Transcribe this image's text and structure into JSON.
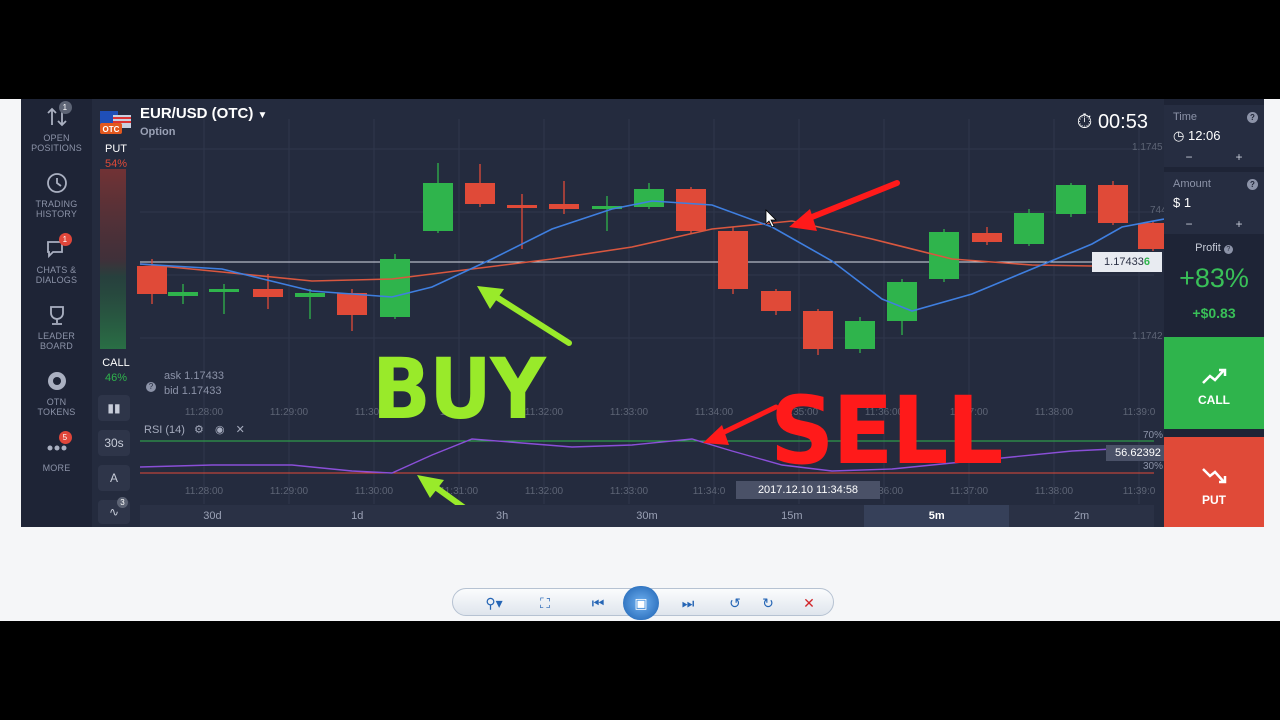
{
  "pair": {
    "title": "EUR/USD (OTC)",
    "subtitle": "Option",
    "flag_text": "OTC"
  },
  "timer": "00:53",
  "sidebar": {
    "items": [
      {
        "label1": "OPEN",
        "label2": "POSITIONS",
        "badge": "1"
      },
      {
        "label1": "TRADING",
        "label2": "HISTORY",
        "badge": ""
      },
      {
        "label1": "CHATS &",
        "label2": "DIALOGS",
        "badge": "1"
      },
      {
        "label1": "LEADER",
        "label2": "BOARD",
        "badge": ""
      },
      {
        "label1": "OTN",
        "label2": "TOKENS",
        "badge": ""
      },
      {
        "label1": "MORE",
        "label2": "",
        "badge": "5"
      }
    ]
  },
  "sentiment": {
    "put_label": "PUT",
    "put_pct": "54%",
    "call_label": "CALL",
    "call_pct": "46%"
  },
  "quotes": {
    "ask": "ask 1.17433",
    "bid": "bid 1.17433"
  },
  "price_axis": {
    "top": "1.1745",
    "mid": "744",
    "bottom": "1.1742",
    "current_main": "1.17433",
    "current_tail": "6"
  },
  "time_axis_main": [
    "11:28:00",
    "11:29:00",
    "11:30:00",
    "11:31:00",
    "11:32:00",
    "11:33:00",
    "11:34:00",
    "11:35:00",
    "11:36:00",
    "11:37:00",
    "11:38:00",
    "11:39:0"
  ],
  "time_axis_rsi": [
    "11:28:00",
    "11:29:00",
    "11:30:00",
    "11:31:00",
    "11:32:00",
    "11:33:00",
    "11:34:0",
    "11:36:00",
    "11:37:00",
    "11:38:00",
    "11:39:0"
  ],
  "crosshair_time": "2017.12.10 11:34:58",
  "rsi": {
    "label": "RSI (14)",
    "level_high": "70%",
    "level_low": "30%",
    "value": "56.62392"
  },
  "tools": {
    "interval": "30s",
    "draw": "A",
    "indicators_badge": "3"
  },
  "timeframes": [
    {
      "label": "30d",
      "active": false
    },
    {
      "label": "1d",
      "active": false
    },
    {
      "label": "3h",
      "active": false
    },
    {
      "label": "30m",
      "active": false
    },
    {
      "label": "15m",
      "active": false
    },
    {
      "label": "5m",
      "active": true
    },
    {
      "label": "2m",
      "active": false
    }
  ],
  "right_panel": {
    "time_label": "Time",
    "time_value": "12:06",
    "amount_label": "Amount",
    "amount_value": "$ 1",
    "minus": "−",
    "plus": "+",
    "profit_label": "Profit",
    "profit_pct": "+83%",
    "profit_usd": "+$0.83",
    "call_label": "CALL",
    "put_label": "PUT"
  },
  "annotations": {
    "buy": "BUY",
    "sell": "SELL"
  },
  "colors": {
    "up": "#2fb44c",
    "down": "#e04a38",
    "sma_fast": "#3f7fe0",
    "sma_slow": "#d9573f",
    "rsi_line": "#8a4fd8",
    "buy_ann": "#99ea2a",
    "sell_ann": "#ff1a1a"
  }
}
